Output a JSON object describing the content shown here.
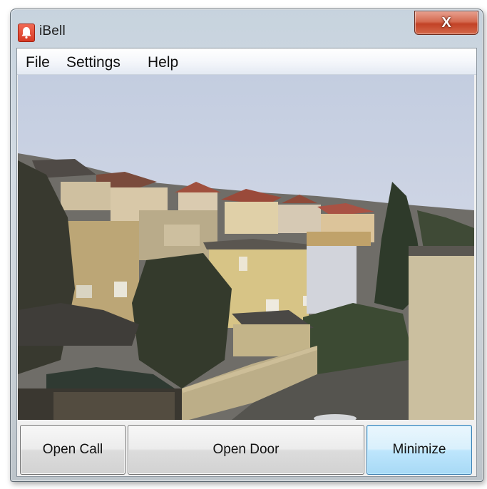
{
  "window": {
    "title": "iBell",
    "close_glyph": "X",
    "app_icon": "bell-icon",
    "accent_close": "#c8462c"
  },
  "menu": {
    "items": [
      {
        "label": "File"
      },
      {
        "label": "Settings"
      },
      {
        "label": "Help"
      }
    ]
  },
  "camera": {
    "content": "live camera view"
  },
  "buttons": {
    "open_call": "Open Call",
    "open_door": "Open Door",
    "minimize": "Minimize"
  }
}
